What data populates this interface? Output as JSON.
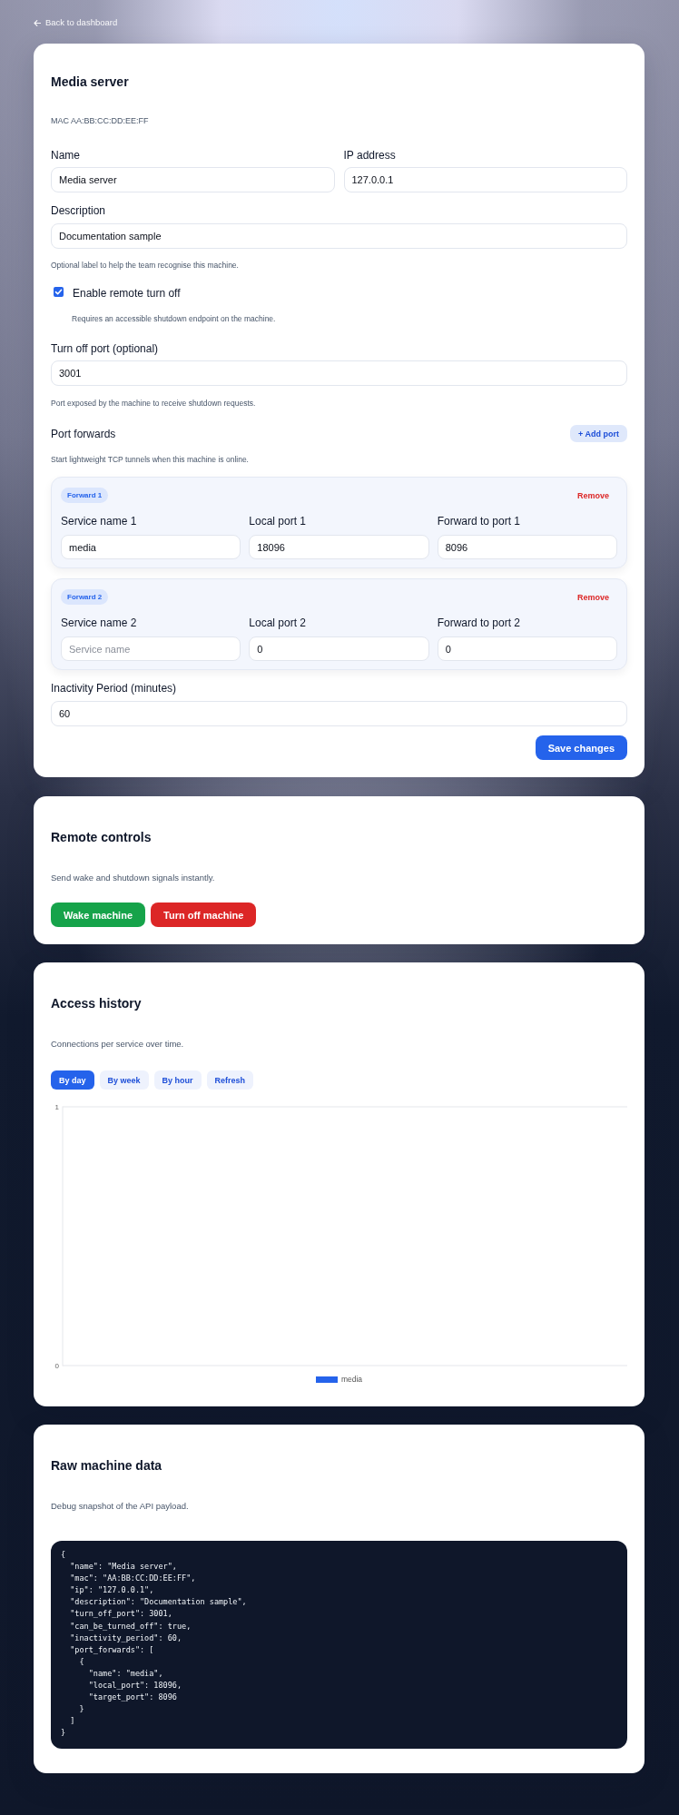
{
  "back_link": {
    "label": "Back to dashboard"
  },
  "machine": {
    "title": "Media server",
    "mac": "MAC AA:BB:CC:DD:EE:FF",
    "name": {
      "label": "Name",
      "value": "Media server"
    },
    "ip": {
      "label": "IP address",
      "value": "127.0.0.1"
    },
    "description": {
      "label": "Description",
      "value": "Documentation sample",
      "hint": "Optional label to help the team recognise this machine."
    },
    "remote_turn_off": {
      "label": "Enable remote turn off",
      "checked": true,
      "hint": "Requires an accessible shutdown endpoint on the machine."
    },
    "turn_off_port": {
      "label": "Turn off port (optional)",
      "value": "3001",
      "hint": "Port exposed by the machine to receive shutdown requests."
    },
    "port_forwards": {
      "title": "Port forwards",
      "add_button": "+ Add port",
      "hint": "Start lightweight TCP tunnels when this machine is online.",
      "items": [
        {
          "badge": "Forward 1",
          "remove": "Remove",
          "fields": [
            {
              "label": "Service name 1",
              "value": "media"
            },
            {
              "label": "Local port 1",
              "value": "18096"
            },
            {
              "label": "Forward to port 1",
              "value": "8096"
            }
          ]
        },
        {
          "badge": "Forward 2",
          "remove": "Remove",
          "fields": [
            {
              "label": "Service name 2",
              "placeholder": "Service name"
            },
            {
              "label": "Local port 2",
              "value": "0"
            },
            {
              "label": "Forward to port 2",
              "value": "0"
            }
          ]
        }
      ]
    },
    "inactivity": {
      "label": "Inactivity Period (minutes)",
      "value": "60"
    },
    "save_button": "Save changes"
  },
  "remote_controls": {
    "title": "Remote controls",
    "subtitle": "Send wake and shutdown signals instantly.",
    "buttons": [
      {
        "label": "Wake machine",
        "kind": "success"
      },
      {
        "label": "Turn off machine",
        "kind": "danger"
      }
    ]
  },
  "access_history": {
    "title": "Access history",
    "subtitle": "Connections per service over time.",
    "tabs": [
      {
        "label": "By day",
        "selected": true
      },
      {
        "label": "By week",
        "selected": false
      },
      {
        "label": "By hour",
        "selected": false
      }
    ],
    "refresh_button": "Refresh",
    "chart_data": {
      "type": "bar",
      "series": [
        {
          "name": "media",
          "color": "#2563eb"
        }
      ],
      "ylim": [
        0,
        1
      ],
      "yticks": [
        0,
        1
      ]
    }
  },
  "raw_data": {
    "title": "Raw machine data",
    "subtitle": "Debug snapshot of the API payload.",
    "code": "{\n  \"name\": \"Media server\",\n  \"mac\": \"AA:BB:CC:DD:EE:FF\",\n  \"ip\": \"127.0.0.1\",\n  \"description\": \"Documentation sample\",\n  \"turn_off_port\": 3001,\n  \"can_be_turned_off\": true,\n  \"inactivity_period\": 60,\n  \"port_forwards\": [\n    {\n      \"name\": \"media\",\n      \"local_port\": 18096,\n      \"target_port\": 8096\n    }\n  ]\n}"
  }
}
